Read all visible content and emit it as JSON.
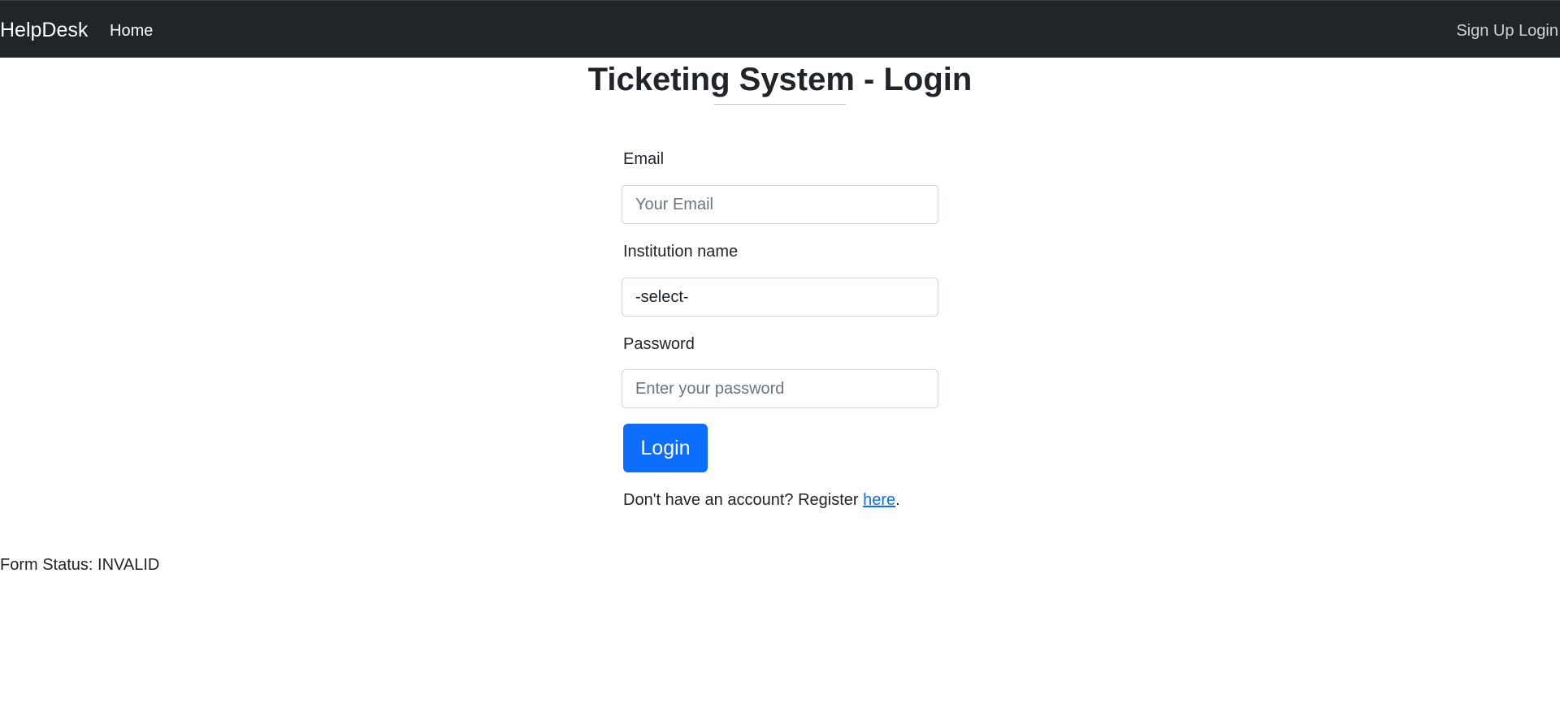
{
  "navbar": {
    "brand": "HelpDesk",
    "home_label": "Home",
    "signup_label": "Sign Up",
    "login_label": "Login"
  },
  "page": {
    "title": "Ticketing System - Login"
  },
  "form": {
    "email": {
      "label": "Email",
      "value": "",
      "placeholder": "Your Email"
    },
    "institution": {
      "label": "Institution name",
      "selected": "-select-"
    },
    "password": {
      "label": "Password",
      "value": "",
      "placeholder": "Enter your password"
    },
    "submit_label": "Login",
    "register_prompt": "Don't have an account? Register ",
    "register_link": "here",
    "register_suffix": "."
  },
  "status": {
    "text": "Form Status: INVALID"
  },
  "colors": {
    "navbar_bg": "#212529",
    "primary": "#0d6efd"
  }
}
